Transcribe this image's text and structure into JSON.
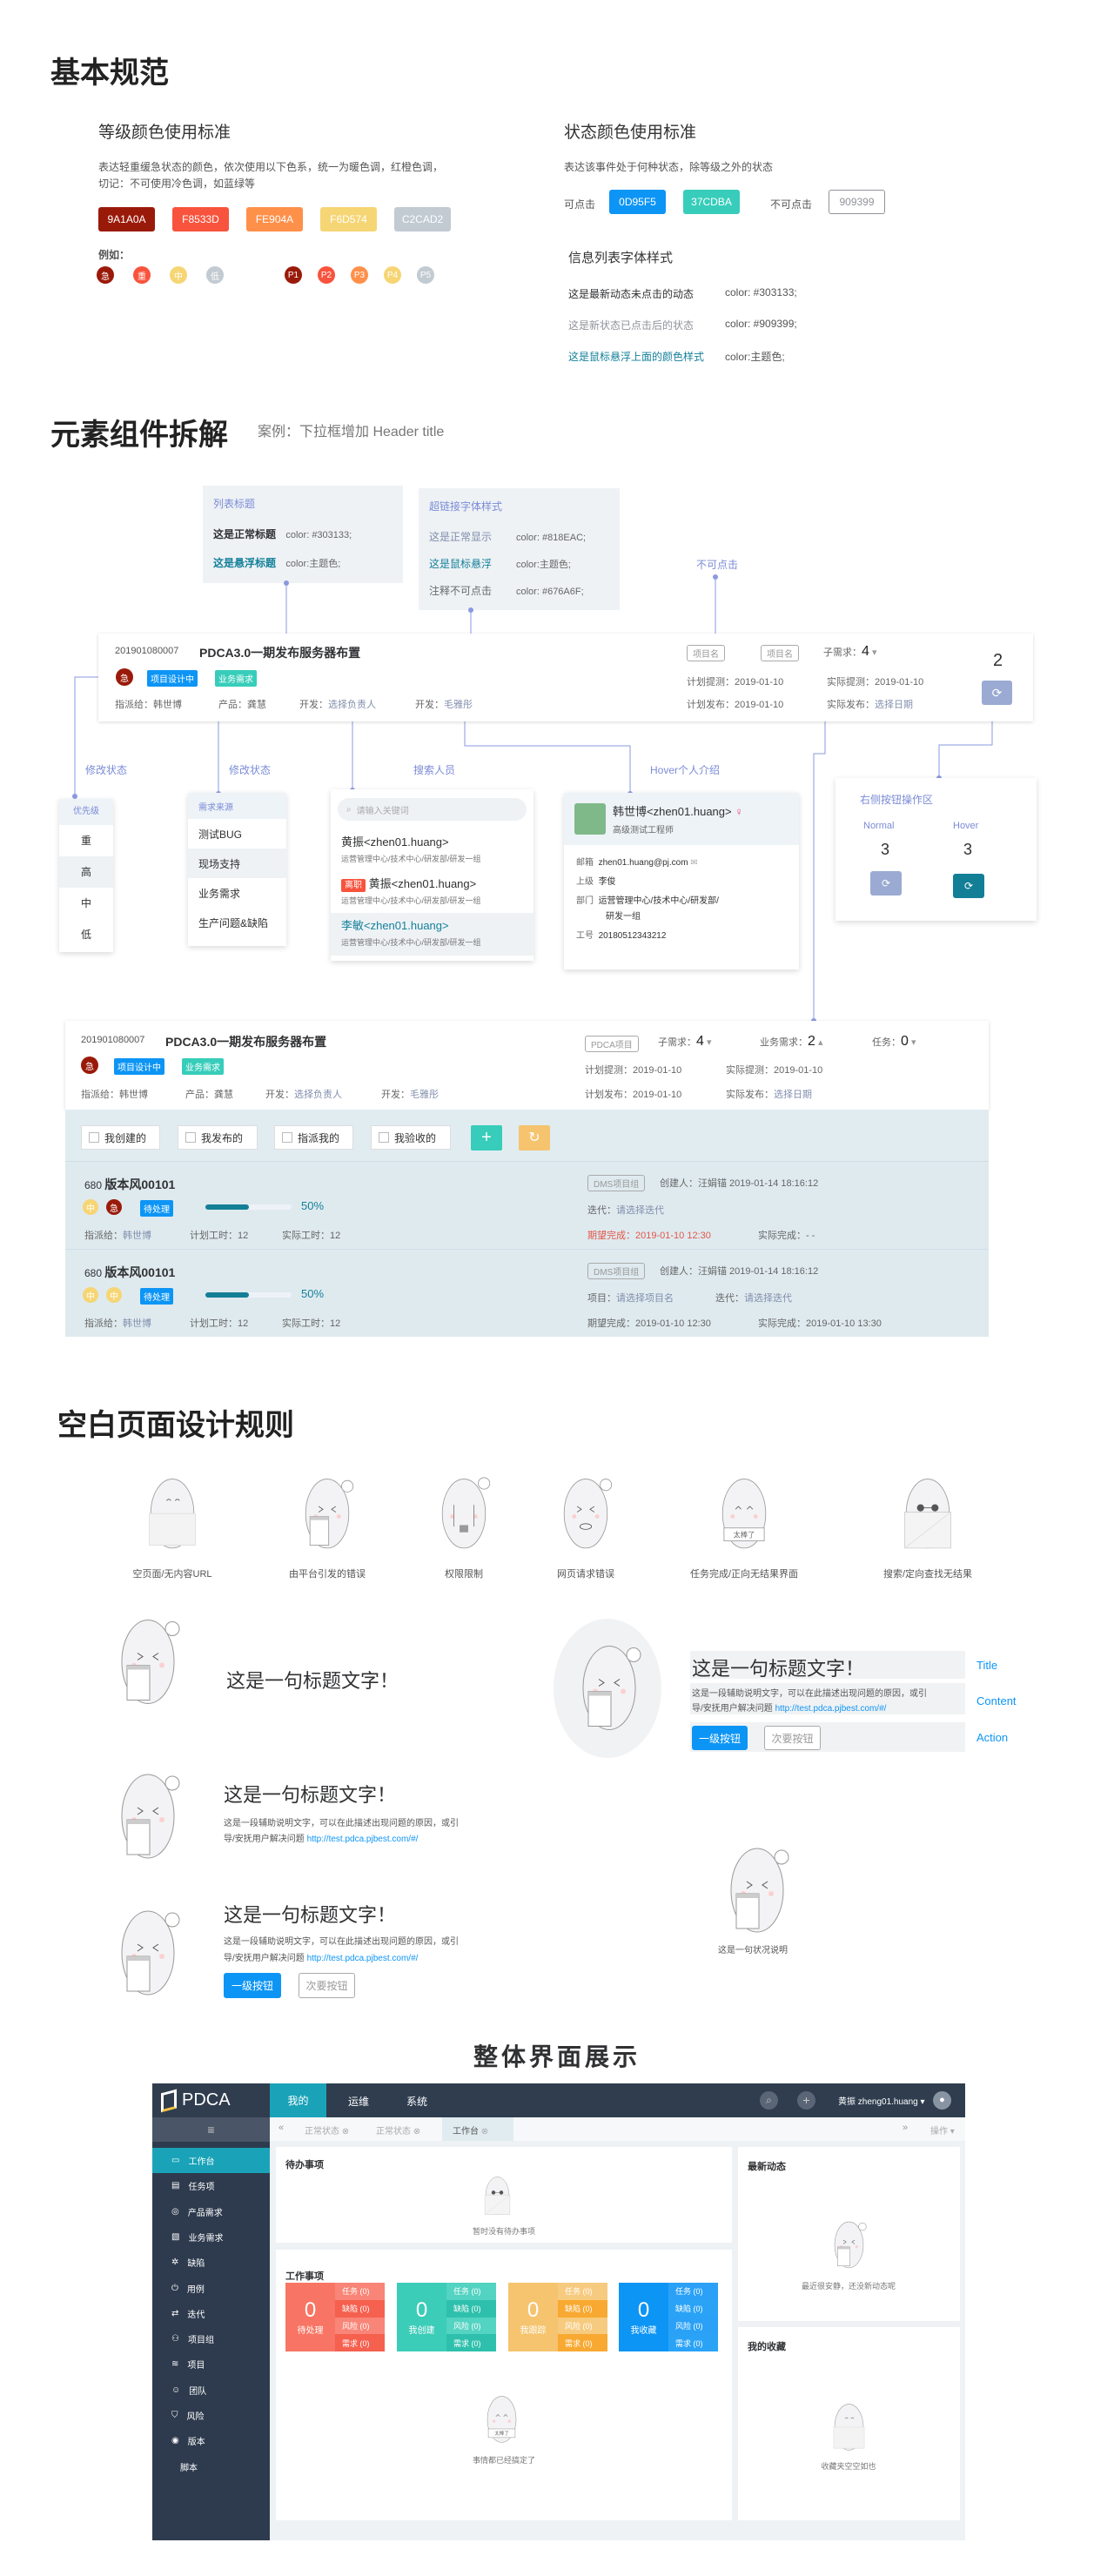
{
  "s1": {
    "title": "基本规范",
    "grade": {
      "title": "等级颜色使用标准",
      "desc1": "表达轻重缓急状态的颜色，依次使用以下色系，统一为暖色调，红橙色调，",
      "desc2": "切记：不可使用冷色调，如蓝绿等",
      "swatches": [
        {
          "label": "9A1A0A",
          "color": "#9a1a0a"
        },
        {
          "label": "F8533D",
          "color": "#f8533d"
        },
        {
          "label": "FE904A",
          "color": "#fe904a"
        },
        {
          "label": "F6D574",
          "color": "#f6d574"
        },
        {
          "label": "C2CAD2",
          "color": "#c2cad2"
        }
      ],
      "example": "例如：",
      "levels": [
        "急",
        "重",
        "中",
        "低"
      ],
      "priorities": [
        "P1",
        "P2",
        "P3",
        "P4",
        "P5"
      ]
    },
    "state": {
      "title": "状态颜色使用标准",
      "desc": "表达该事件处于何种状态，除等级之外的状态",
      "clickable": "可点击",
      "c1": "0D95F5",
      "c2": "37CDBA",
      "unclickable": "不可点击",
      "c3": "909399"
    },
    "info": {
      "title": "信息列表字体样式",
      "rows": [
        {
          "t": "这是最新动态未点击的动态",
          "c": "color: #303133;"
        },
        {
          "t": "这是新状态已点击后的状态",
          "c": "color: #909399;"
        },
        {
          "t": "这是鼠标悬浮上面的颜色样式",
          "c": "color:主题色;"
        }
      ]
    }
  },
  "s2": {
    "title": "元素组件拆解",
    "sub": "案例：下拉框增加 Header title",
    "listTitle": {
      "head": "列表标题",
      "r1": "这是正常标题",
      "c1": "color: #303133;",
      "r2": "这是悬浮标题",
      "c2": "color:主题色;"
    },
    "link": {
      "head": "超链接字体样式",
      "r1": "这是正常显示",
      "c1": "color: #818EAC;",
      "r2": "这是鼠标悬浮",
      "c2": "color:主题色;",
      "r3": "注释不可点击",
      "c3": "color: #676A6F;"
    },
    "noclick": "不可点击",
    "card1": {
      "id": "201901080007",
      "title": "PDCA3.0一期发布服务器布置",
      "urgent": "急",
      "tag1": "项目设计中",
      "tag2": "业务需求",
      "assign": "指派给：韩世博",
      "product": "产品：龚慧",
      "dev1k": "开发：",
      "dev1v": "选择负责人",
      "dev2k": "开发：",
      "dev2v": "毛雅彤",
      "proj1": "项目名",
      "proj2": "项目名",
      "subreq": "子需求：",
      "subreqv": "4",
      "plantest": "计划提测：2019-01-10",
      "acttest": "实际提测：2019-01-10",
      "planrel": "计划发布：2019-01-10",
      "actrelk": "实际发布：",
      "actrelv": "选择日期",
      "count": "2"
    },
    "labels": {
      "modify1": "修改状态",
      "modify2": "修改状态",
      "search": "搜索人员",
      "hover": "Hover个人介绍"
    },
    "priority": {
      "head": "优先级",
      "items": [
        "重",
        "高",
        "中",
        "低"
      ]
    },
    "source": {
      "head": "需求来源",
      "items": [
        "测试BUG",
        "现场支持",
        "业务需求",
        "生产问题&缺陷"
      ]
    },
    "people": {
      "placeholder": "请输入关键词",
      "items": [
        {
          "name": "黄振<zhen01.huang>",
          "dept": "运营管理中心/技术中心/研发部/研发一组"
        },
        {
          "badge": "离职",
          "name": "黄振<zhen01.huang>",
          "dept": "运营管理中心/技术中心/研发部/研发一组"
        },
        {
          "name": "李敏<zhen01.huang>",
          "dept": "运营管理中心/技术中心/研发部/研发一组"
        }
      ]
    },
    "profile": {
      "name": "韩世博<zhen01.huang>",
      "title": "高级测试工程师",
      "mailk": "邮箱",
      "mail": "zhen01.huang@pj.com",
      "supk": "上级",
      "sup": "李俊",
      "deptk": "部门",
      "dept1": "运营管理中心/技术中心/研发部/",
      "dept2": "研发一组",
      "nok": "工号",
      "no": "20180512343212"
    },
    "actions": {
      "head": "右侧按钮操作区",
      "normal": "Normal",
      "hover": "Hover",
      "n1": "3",
      "n2": "3"
    },
    "card2": {
      "id": "201901080007",
      "title": "PDCA3.0一期发布服务器布置",
      "urgent": "急",
      "tag1": "项目设计中",
      "tag2": "业务需求",
      "assign": "指派给：韩世博",
      "product": "产品：龚慧",
      "dev1k": "开发：",
      "dev1v": "选择负责人",
      "dev2k": "开发：",
      "dev2v": "毛雅彤",
      "proj": "PDCA项目",
      "subreqk": "子需求：",
      "subreqv": "4",
      "bizk": "业务需求：",
      "bizv": "2",
      "taskk": "任务：",
      "taskv": "0",
      "plantest": "计划提测：2019-01-10",
      "acttest": "实际提测：2019-01-10",
      "planrel": "计划发布：2019-01-10",
      "actrelk": "实际发布：",
      "actrelv": "选择日期"
    },
    "filters": [
      "我创建的",
      "我发布的",
      "指派我的",
      "我验收的"
    ],
    "rows": [
      {
        "num": "680",
        "title": "版本风00101",
        "b1": "中",
        "b2": "急",
        "status": "待处理",
        "progress": 50,
        "pct": "50%",
        "assignk": "指派给：",
        "assignv": "韩世博",
        "plan": "计划工时：12",
        "act": "实际工时：12",
        "group": "DMS项目组",
        "creator": "创建人：汪娟锚 2019-01-14 18:16:12",
        "l2k": "迭代：",
        "l2v": "请选择迭代",
        "expect": "期望完成：2019-01-10  12:30",
        "done": "实际完成：- -"
      },
      {
        "num": "680",
        "title": "版本风00101",
        "b1": "中",
        "b2": "中",
        "status": "待处理",
        "progress": 50,
        "pct": "50%",
        "assignk": "指派给：",
        "assignv": "韩世博",
        "plan": "计划工时：12",
        "act": "实际工时：12",
        "group": "DMS项目组",
        "creator": "创建人：汪娟锚 2019-01-14 18:16:12",
        "l2k": "项目：",
        "l2v": "请选择项目名",
        "l3k": "迭代：",
        "l3v": "请选择迭代",
        "expect": "期望完成：2019-01-10  12:30",
        "done": "实际完成：2019-01-10  13:30"
      }
    ]
  },
  "s3": {
    "title": "空白页面设计规则",
    "icons": [
      "空页面/无内容URL",
      "由平台引发的错误",
      "权限限制",
      "网页请求错误",
      "任务完成/正向无结果界面",
      "搜索/定向查找无结果"
    ],
    "sign": "太棒了",
    "headline": "这是一句标题文字！",
    "desc1": "这是一段辅助说明文字，可以在此描述出现问题的原因，或引",
    "desc2": "导/安抚用户解决问题",
    "link": "http://test.pdca.pjbest.com/#/",
    "primary": "一级按钮",
    "secondary": "次要按钮",
    "annTitle": "Title",
    "annContent": "Content",
    "annAction": "Action",
    "status": "这是一句状况说明"
  },
  "s4": {
    "title": "整体界面展示",
    "logo": "PDCA",
    "nav": [
      "我的",
      "运维",
      "系统"
    ],
    "user": "黄振 zheng01.huang",
    "tabs": [
      "正常状态",
      "正常状态",
      "工作台"
    ],
    "ops": "操作",
    "side": [
      "工作台",
      "任务项",
      "产品需求",
      "业务需求",
      "缺陷",
      "用例",
      "迭代",
      "项目组",
      "项目",
      "团队",
      "风险",
      "版本",
      "脚本"
    ],
    "todo": {
      "title": "待办事项",
      "empty": "暂时没有待办事项"
    },
    "work": {
      "title": "工作事项",
      "empty": "事情都已经搞定了",
      "cards": [
        {
          "n": "0",
          "l": "待处理",
          "color": "#f87565",
          "dark": "#f5604f"
        },
        {
          "n": "0",
          "l": "我创建",
          "color": "#3ccdb9",
          "dark": "#2ec0ac"
        },
        {
          "n": "0",
          "l": "我跟踪",
          "color": "#f6c46e",
          "dark": "#f8a931"
        },
        {
          "n": "0",
          "l": "我收藏",
          "color": "#0d95f5",
          "dark": "#2aa3f7"
        }
      ],
      "rows": [
        "任务 (0)",
        "缺陷 (0)",
        "风险 (0)",
        "需求 (0)"
      ]
    },
    "news": {
      "title": "最新动态",
      "empty": "最近很安静，还没新动态呢"
    },
    "fav": {
      "title": "我的收藏",
      "empty": "收藏夹空空如也"
    }
  }
}
